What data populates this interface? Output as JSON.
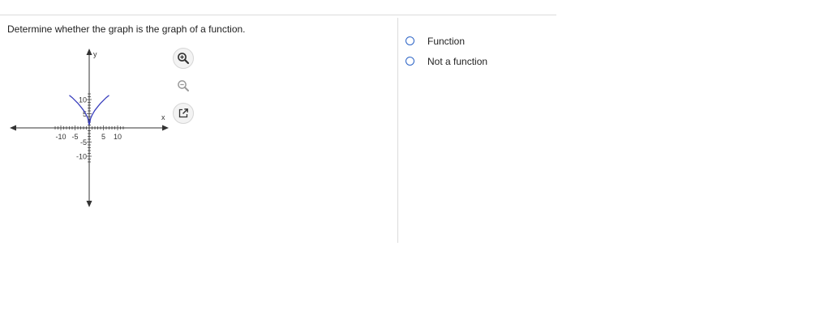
{
  "question": {
    "text": "Determine whether the graph is the graph of a function."
  },
  "graph": {
    "x_axis_label": "x",
    "y_axis_label": "y",
    "x_ticks": [
      "-10",
      "-5",
      "5",
      "10"
    ],
    "y_ticks": [
      "10",
      "5",
      "-5",
      "-10"
    ],
    "curve_color": "#3a3fbd",
    "axis_color": "#333333"
  },
  "chart_data": {
    "type": "line",
    "title": "",
    "xlabel": "x",
    "ylabel": "y",
    "xlim": [
      -12,
      12
    ],
    "ylim": [
      -12,
      12
    ],
    "series": [
      {
        "x": [
          -7,
          -6,
          -5,
          -4,
          -3,
          -2,
          -1.5,
          -1,
          -0.5,
          0,
          0.5,
          1,
          1.5,
          2,
          3,
          4,
          5,
          6,
          7
        ],
        "y": [
          11.5,
          10.7,
          9.7,
          8.7,
          7.5,
          6.2,
          5.4,
          4.5,
          3.4,
          1.1,
          3.4,
          4.5,
          5.4,
          6.2,
          7.5,
          8.7,
          9.7,
          10.7,
          11.5
        ]
      }
    ]
  },
  "tools": {
    "zoom_in_icon": "magnifier-plus-icon",
    "zoom_out_icon": "magnifier-minus-icon",
    "popout_icon": "external-link-icon"
  },
  "options": [
    {
      "label": "Function"
    },
    {
      "label": "Not a function"
    }
  ],
  "colors": {
    "accent": "#2b63c6",
    "divider": "#dcdcdc"
  }
}
